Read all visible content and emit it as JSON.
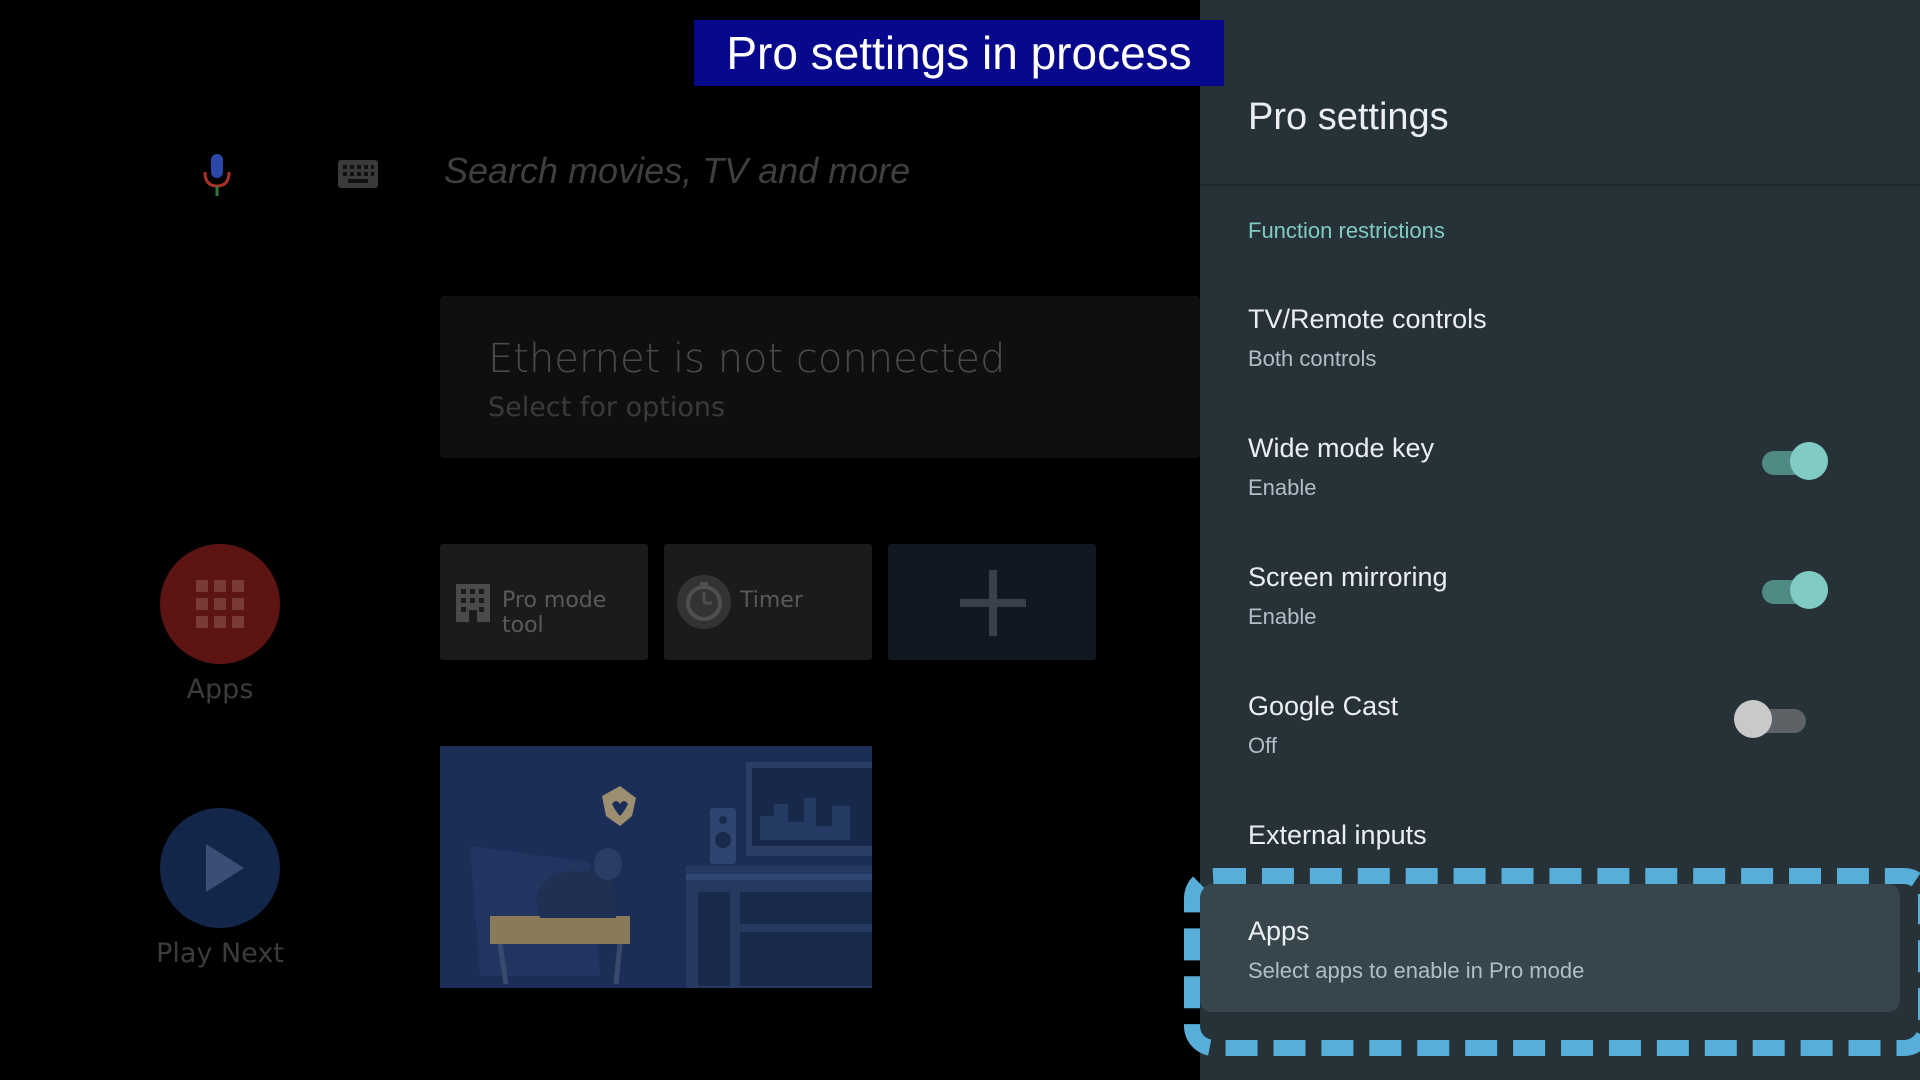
{
  "banner": {
    "text": "Pro settings in process"
  },
  "search": {
    "placeholder": "Search movies, TV and more"
  },
  "icons": {
    "mic": "mic-icon",
    "keyboard": "keyboard-icon",
    "apps": "apps-grid-icon",
    "play": "play-icon",
    "pro_mode": "building-icon",
    "timer": "timer-icon",
    "add": "plus-icon"
  },
  "network_card": {
    "title": "Ethernet is not connected",
    "subtitle": "Select for options"
  },
  "rail": {
    "apps_label": "Apps",
    "play_next_label": "Play Next"
  },
  "tiles": {
    "pro_mode_label": "Pro mode tool",
    "timer_label": "Timer"
  },
  "panel": {
    "title": "Pro settings",
    "section": "Function restrictions",
    "items": [
      {
        "title": "TV/Remote controls",
        "subtitle": "Both controls"
      },
      {
        "title": "Wide mode key",
        "subtitle": "Enable",
        "toggle": "on"
      },
      {
        "title": "Screen mirroring",
        "subtitle": "Enable",
        "toggle": "on"
      },
      {
        "title": "Google Cast",
        "subtitle": "Off",
        "toggle": "off"
      },
      {
        "title": "External inputs",
        "subtitle": ""
      },
      {
        "title": "Apps",
        "subtitle": "Select apps to enable in Pro mode"
      }
    ]
  },
  "colors": {
    "accent": "#80cbc4",
    "focus_dash": "#57aed8",
    "banner_bg": "#08088c",
    "panel_bg": "#263238"
  }
}
